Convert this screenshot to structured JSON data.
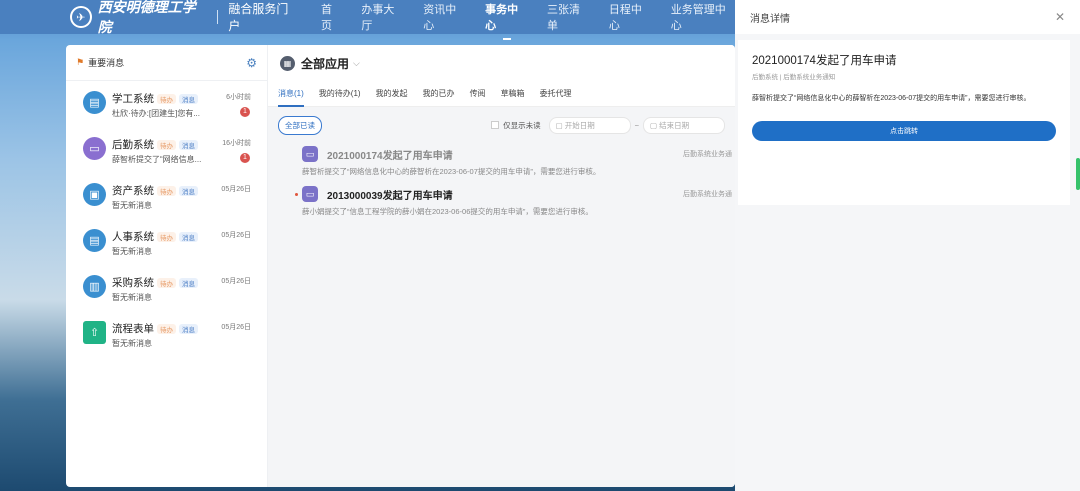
{
  "header": {
    "logo_text": "西安明德理工学院",
    "portal": "融合服务门户",
    "nav": [
      "首页",
      "办事大厅",
      "资讯中心",
      "事务中心",
      "三张清单",
      "日程中心",
      "业务管理中心"
    ],
    "active_nav": 3
  },
  "left": {
    "title": "重要消息",
    "systems": [
      {
        "name": "学工系统",
        "tag1": "待办",
        "tag2": "消息",
        "sub": "杜欣·待办:[团建生]您有...",
        "time": "6小时前",
        "badge": "1",
        "icon": "id-card",
        "color": "#3a8fd0"
      },
      {
        "name": "后勤系统",
        "tag1": "待办",
        "tag2": "消息",
        "sub": "薛智析提交了“网络信息...",
        "time": "16小时前",
        "badge": "1",
        "icon": "calendar",
        "color": "#8a6fd0"
      },
      {
        "name": "资产系统",
        "tag1": "待办",
        "tag2": "消息",
        "sub": "暂无新消息",
        "time": "05月26日",
        "icon": "asset",
        "color": "#3a8fd0"
      },
      {
        "name": "人事系统",
        "tag1": "待办",
        "tag2": "消息",
        "sub": "暂无新消息",
        "time": "05月26日",
        "icon": "id-card",
        "color": "#3a8fd0"
      },
      {
        "name": "采购系统",
        "tag1": "待办",
        "tag2": "消息",
        "sub": "暂无新消息",
        "time": "05月26日",
        "icon": "document",
        "color": "#3a8fd0"
      },
      {
        "name": "流程表单",
        "tag1": "待办",
        "tag2": "消息",
        "sub": "暂无新消息",
        "time": "05月26日",
        "icon": "upload",
        "color": "#20b386"
      }
    ]
  },
  "right": {
    "title": "全部应用",
    "tabs": [
      "消息(1)",
      "我的待办(1)",
      "我的发起",
      "我的已办",
      "传阅",
      "草稿箱",
      "委托代理"
    ],
    "read_all": "全部已读",
    "unread_only": "仅显示未读",
    "start_placeholder": "开始日期",
    "end_placeholder": "结束日期",
    "messages": [
      {
        "title": "2021000174发起了用车申请",
        "source": "后勤系统业务通",
        "desc": "薛智析提交了“网络信息化中心的薛智析在2023-06-07提交的用车申请”，需要您进行审核。",
        "unread": false
      },
      {
        "title": "2013000039发起了用车申请",
        "source": "后勤系统业务通",
        "desc": "薛小娟提交了“信息工程学院的薛小娟在2023-06-06提交的用车申请”，需要您进行审核。",
        "unread": true
      }
    ]
  },
  "drawer": {
    "title": "消息详情",
    "card_title": "2021000174发起了用车申请",
    "meta": "后勤系统 | 后勤系统业务通知",
    "text": "薛智析提交了“网络信息化中心的薛智析在2023-06-07提交的用车申请”，需要您进行审核。",
    "button": "点击跳转"
  }
}
